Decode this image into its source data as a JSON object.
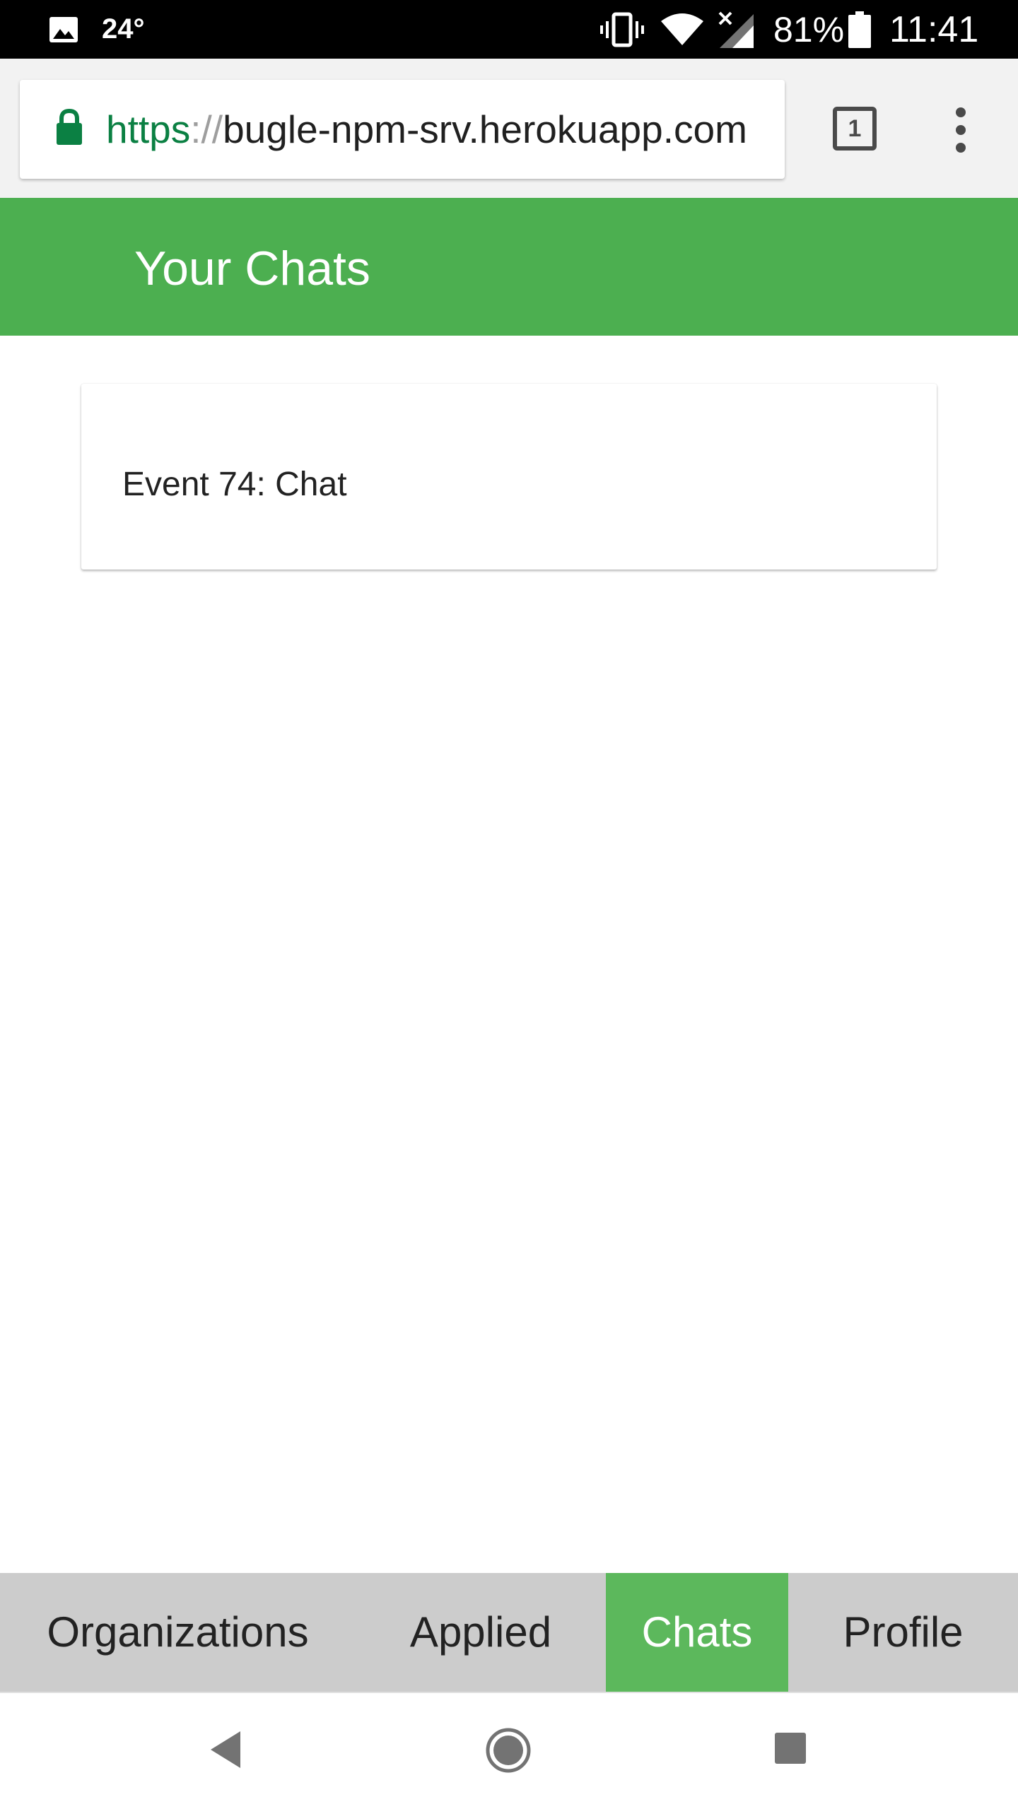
{
  "status_bar": {
    "temperature": "24°",
    "battery_percent": "81%",
    "time": "11:41",
    "icons": [
      "gallery-icon",
      "vibrate-icon",
      "wifi-icon",
      "cell-signal-icon",
      "battery-icon"
    ]
  },
  "browser": {
    "url_scheme": "https",
    "url_separator": "://",
    "url_host": "bugle-npm-srv.herokuapp.com",
    "tab_count": "1",
    "icons": [
      "lock-icon",
      "tabs-icon",
      "more-vert-icon"
    ]
  },
  "header": {
    "title": "Your Chats"
  },
  "chats": [
    {
      "title": "Event 74: Chat"
    }
  ],
  "bottom_nav": {
    "items": [
      {
        "label": "Organizations",
        "active": false
      },
      {
        "label": "Applied",
        "active": false
      },
      {
        "label": "Chats",
        "active": true
      },
      {
        "label": "Profile",
        "active": false
      }
    ]
  },
  "system_nav": {
    "icons": [
      "back-icon",
      "home-icon",
      "recents-icon"
    ]
  },
  "colors": {
    "header_green": "#4caf50",
    "active_tab_green": "#5cb85c",
    "nav_background": "#cccccc",
    "secure_url_green": "#0b8043"
  }
}
